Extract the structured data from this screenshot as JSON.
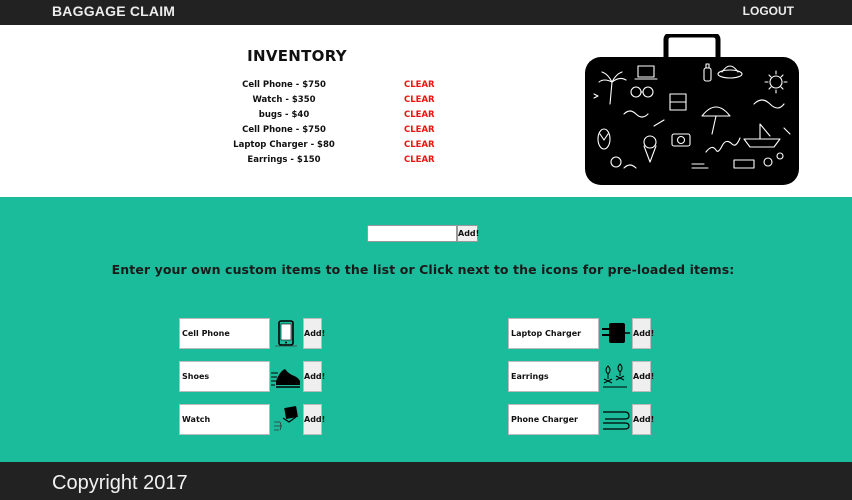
{
  "navbar": {
    "brand": "BAGGAGE CLAIM",
    "logout": "LOGOUT"
  },
  "inventory": {
    "title": "INVENTORY",
    "clear_label": "CLEAR",
    "items": [
      {
        "label": "Cell Phone - $750"
      },
      {
        "label": "Watch - $350"
      },
      {
        "label": "bugs - $40"
      },
      {
        "label": "Cell Phone - $750"
      },
      {
        "label": "Laptop Charger - $80"
      },
      {
        "label": "Earrings - $150"
      }
    ]
  },
  "custom": {
    "add_label": "Add!",
    "input_value": ""
  },
  "instructions": "Enter your own custom items to the list or Click next to the icons for pre-loaded items:",
  "preloaded": {
    "add_label": "Add!",
    "left": [
      {
        "name": "Cell Phone",
        "icon": "cell-phone-icon"
      },
      {
        "name": "Shoes",
        "icon": "shoe-icon"
      },
      {
        "name": "Watch",
        "icon": "watch-icon"
      }
    ],
    "right": [
      {
        "name": "Laptop Charger",
        "icon": "laptop-charger-icon"
      },
      {
        "name": "Earrings",
        "icon": "earrings-icon"
      },
      {
        "name": "Phone Charger",
        "icon": "phone-charger-icon"
      }
    ]
  },
  "footer": {
    "copyright": "Copyright 2017"
  },
  "colors": {
    "navbar": "#222222",
    "green": "#1bbc9b",
    "clear": "#ee1111"
  }
}
